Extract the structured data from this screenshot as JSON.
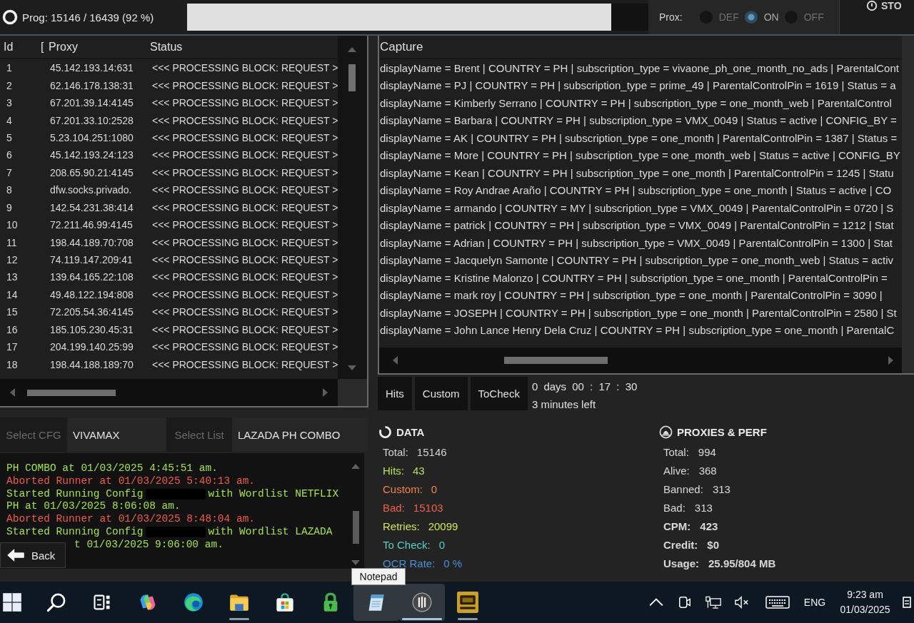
{
  "top_bar": {
    "progress_text": "Prog: 15146 / 16439 (92 %)",
    "progress": {
      "level": 0.92
    },
    "proxy_mode": {
      "label": "Prox:",
      "options": [
        {
          "label": "DEF",
          "selected": false
        },
        {
          "label": "ON",
          "selected": true
        },
        {
          "label": "OFF",
          "selected": false
        }
      ]
    },
    "stop_button": {
      "label": "STO"
    }
  },
  "runner_table": {
    "columns": [
      "Id",
      "[",
      "Proxy",
      "Status"
    ],
    "rows": [
      {
        "id": "1",
        "proxy": "45.142.193.14:631",
        "status": "<<< PROCESSING BLOCK: REQUEST >"
      },
      {
        "id": "2",
        "proxy": "62.146.178.138:31",
        "status": "<<< PROCESSING BLOCK: REQUEST >"
      },
      {
        "id": "3",
        "proxy": "67.201.39.14:4145",
        "status": "<<< PROCESSING BLOCK: REQUEST >"
      },
      {
        "id": "4",
        "proxy": "67.201.33.10:2528",
        "status": "<<< PROCESSING BLOCK: REQUEST >"
      },
      {
        "id": "5",
        "proxy": "5.23.104.251:1080",
        "status": "<<< PROCESSING BLOCK: REQUEST >"
      },
      {
        "id": "6",
        "proxy": "45.142.193.24:123",
        "status": "<<< PROCESSING BLOCK: REQUEST >"
      },
      {
        "id": "7",
        "proxy": "208.65.90.21:4145",
        "status": "<<< PROCESSING BLOCK: REQUEST >"
      },
      {
        "id": "8",
        "proxy": "dfw.socks.privado.",
        "status": "<<< PROCESSING BLOCK: REQUEST >"
      },
      {
        "id": "9",
        "proxy": "142.54.231.38:414",
        "status": "<<< PROCESSING BLOCK: REQUEST >"
      },
      {
        "id": "10",
        "proxy": "72.211.46.99:4145",
        "status": "<<< PROCESSING BLOCK: REQUEST >"
      },
      {
        "id": "11",
        "proxy": "198.44.189.70:708",
        "status": "<<< PROCESSING BLOCK: REQUEST >"
      },
      {
        "id": "12",
        "proxy": "74.119.147.209:41",
        "status": "<<< PROCESSING BLOCK: REQUEST >"
      },
      {
        "id": "13",
        "proxy": "139.64.165.22:108",
        "status": "<<< PROCESSING BLOCK: REQUEST >"
      },
      {
        "id": "14",
        "proxy": "49.48.122.194:808",
        "status": "<<< PROCESSING BLOCK: REQUEST >"
      },
      {
        "id": "15",
        "proxy": "72.205.54.36:4145",
        "status": "<<< PROCESSING BLOCK: REQUEST >"
      },
      {
        "id": "16",
        "proxy": "185.105.230.45:31",
        "status": "<<< PROCESSING BLOCK: REQUEST >"
      },
      {
        "id": "17",
        "proxy": "204.199.140.25:99",
        "status": "<<< PROCESSING BLOCK: REQUEST >"
      },
      {
        "id": "18",
        "proxy": "198.44.188.189:70",
        "status": "<<< PROCESSING BLOCK: REQUEST >"
      }
    ]
  },
  "capture_table": {
    "columns": [
      "Capture"
    ],
    "rows": [
      "displayName = Brent | COUNTRY = PH | subscription_type = vivaone_ph_one_month_no_ads | ParentalCont",
      "displayName = PJ | COUNTRY = PH | subscription_type = prime_49 | ParentalControlPin = 1619 | Status = a",
      "displayName = Kimberly Serrano | COUNTRY = PH | subscription_type = one_month_web | ParentalControl",
      "displayName = Barbara | COUNTRY = PH | subscription_type = VMX_0049 | Status = active | CONFIG_BY =",
      "displayName = AK | COUNTRY = PH | subscription_type = one_month | ParentalControlPin = 1387 | Status =",
      "displayName = More | COUNTRY = PH | subscription_type = one_month_web | Status = active | CONFIG_BY",
      "displayName = Kean | COUNTRY = PH | subscription_type = one_month | ParentalControlPin = 1245 | Statu",
      "displayName = Roy Andrae Araño | COUNTRY = PH | subscription_type = one_month | Status = active | CO",
      "displayName = armando | COUNTRY = MY | subscription_type = VMX_0049 | ParentalControlPin = 0720 | S",
      "displayName = patrick | COUNTRY = PH | subscription_type = VMX_0049 | ParentalControlPin = 1212 | Stat",
      "displayName = Adrian | COUNTRY = PH | subscription_type = VMX_0049 | ParentalControlPin = 1300 | Stat",
      "displayName = Jacquelyn Samonte | COUNTRY = PH | subscription_type = one_month_web | Status = activ",
      "displayName = Kristine Malonzo | COUNTRY = PH | subscription_type = one_month | ParentalControlPin =",
      "displayName = mark roy | COUNTRY = PH | subscription_type = one_month | ParentalControlPin = 3090 |",
      "displayName = JOSEPH | COUNTRY = PH | subscription_type = one_month | ParentalControlPin = 2580 | St",
      "displayName = John Lance Henry Dela Cruz | COUNTRY = PH | subscription_type = one_month | ParentalC"
    ]
  },
  "result_tabs": [
    "Hits",
    "Custom",
    "ToCheck"
  ],
  "timer": {
    "elapsed": "0 days 00 : 17 : 30",
    "remaining": "3 minutes left"
  },
  "config_bar": [
    {
      "button": "Select CFG",
      "value": "VIVAMAX",
      "disabled": true
    },
    {
      "button": "Select List",
      "value": "LAZADA PH COMBO",
      "disabled": true
    }
  ],
  "log": {
    "lines": [
      {
        "kind": "info",
        "segments": [
          {
            "kind": "text",
            "text": "PH COMBO at 01/03/2025 4:45:51 am."
          }
        ]
      },
      {
        "kind": "error",
        "segments": [
          {
            "kind": "text",
            "text": "Aborted Runner at 01/03/2025 5:40:13 am."
          }
        ]
      },
      {
        "kind": "info",
        "segments": [
          {
            "kind": "text",
            "text": "Started Running Config"
          },
          {
            "kind": "redaction"
          },
          {
            "kind": "text",
            "text": "with Wordlist NETFLIX"
          }
        ]
      },
      {
        "kind": "info",
        "segments": [
          {
            "kind": "text",
            "text": "PH at 01/03/2025 8:06:08 am."
          }
        ]
      },
      {
        "kind": "error",
        "segments": [
          {
            "kind": "text",
            "text": "Aborted Runner at 01/03/2025 8:48:04 am."
          }
        ]
      },
      {
        "kind": "info",
        "segments": [
          {
            "kind": "text",
            "text": "Started Running Config"
          },
          {
            "kind": "redaction"
          },
          {
            "kind": "text",
            "text": "with Wordlist LAZADA"
          }
        ]
      },
      {
        "kind": "info",
        "segments": [
          {
            "kind": "text",
            "text": "t 01/03/2025 9:06:00 am."
          }
        ]
      }
    ]
  },
  "back_button": {
    "label": "Back"
  },
  "data_stats": {
    "title": "DATA",
    "items": [
      {
        "label": "Total:",
        "value": "15146",
        "color": "#d2d2d2"
      },
      {
        "label": "Hits:",
        "value": "43",
        "color": "#b2e05a"
      },
      {
        "label": "Custom:",
        "value": "0",
        "color": "#f0824c"
      },
      {
        "label": "Bad:",
        "value": "15103",
        "color": "#f05f50"
      },
      {
        "label": "Retries:",
        "value": "20099",
        "color": "#cfe65a"
      },
      {
        "label": "To Check:",
        "value": "0",
        "color": "#5ccfc9"
      },
      {
        "label": "OCR Rate:",
        "value": "0 %",
        "color": "#4b8fd9"
      }
    ]
  },
  "proxy_stats": {
    "title": "PROXIES & PERF",
    "items": [
      {
        "label": "Total:",
        "value": "994",
        "bold": false
      },
      {
        "label": "Alive:",
        "value": "368",
        "bold": false
      },
      {
        "label": "Banned:",
        "value": "313",
        "bold": false
      },
      {
        "label": "Bad:",
        "value": "313",
        "bold": false
      },
      {
        "label": "CPM:",
        "value": "423",
        "bold": true
      },
      {
        "label": "Credit:",
        "value": "$0",
        "bold": true
      },
      {
        "label": "Usage:",
        "value": "25.95/804 MB",
        "bold": true
      }
    ]
  },
  "tooltip": {
    "text": "Notepad"
  },
  "taskbar": {
    "apps": [
      {
        "running": false,
        "highlighted": false
      },
      {
        "running": false,
        "highlighted": false
      },
      {
        "running": false,
        "highlighted": false
      },
      {
        "running": false,
        "highlighted": false
      },
      {
        "running": false,
        "highlighted": false
      },
      {
        "running": true,
        "highlighted": false
      },
      {
        "running": false,
        "highlighted": false
      },
      {
        "running": false,
        "highlighted": false
      },
      {
        "running": false,
        "highlighted": true
      },
      {
        "running": true,
        "highlighted": true
      },
      {
        "running": true,
        "highlighted": false
      }
    ],
    "language": "ENG",
    "time": "9:23 am",
    "date": "01/03/2025"
  }
}
